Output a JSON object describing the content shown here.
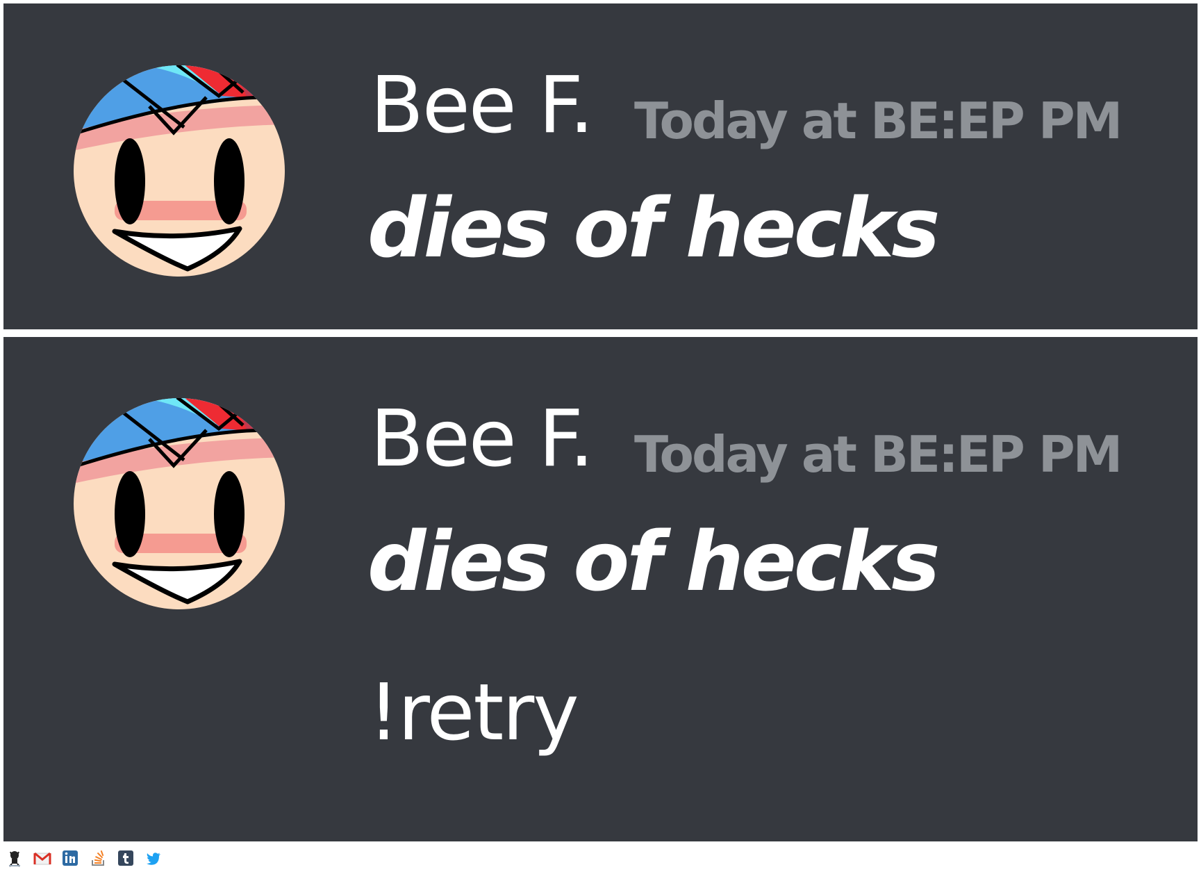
{
  "panels": [
    {
      "username": "Bee F.",
      "timestamp": "Today at BE:EP PM",
      "message": "dies of hecks"
    },
    {
      "username": "Bee F.",
      "timestamp": "Today at BE:EP PM",
      "message": "dies of hecks",
      "command": "!retry"
    }
  ],
  "footer_icons": [
    "github-icon",
    "gmail-icon",
    "linkedin-icon",
    "stackoverflow-icon",
    "tumblr-icon",
    "twitter-icon"
  ],
  "colors": {
    "panel_bg": "#36393f",
    "username": "#ffffff",
    "timestamp": "#8e9297",
    "message": "#ffffff"
  }
}
